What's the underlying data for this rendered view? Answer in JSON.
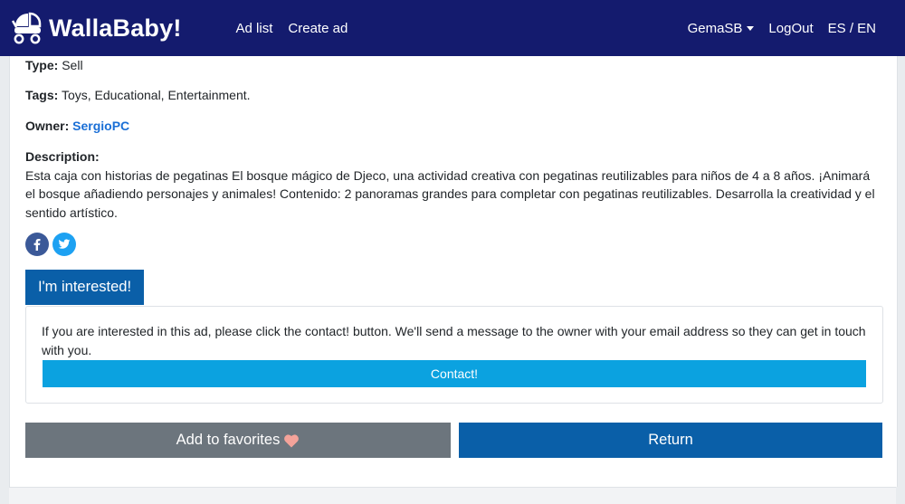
{
  "navbar": {
    "brand": "WallaBaby!",
    "links": [
      "Ad list",
      "Create ad"
    ],
    "user": "GemaSB",
    "logout": "LogOut",
    "lang": "ES / EN",
    "background": "#141b6e"
  },
  "ad": {
    "type_label": "Type:",
    "type_value": "Sell",
    "tags_label": "Tags:",
    "tags_value": "Toys, Educational, Entertainment.",
    "owner_label": "Owner:",
    "owner_value": "SergioPC",
    "description_label": "Description:",
    "description_text": "Esta caja con historias de pegatinas El bosque mágico de Djeco, una actividad creativa con pegatinas reutilizables para niños de 4 a 8 años. ¡Animará el bosque añadiendo personajes y animales! Contenido: 2 panoramas grandes para completar con pegatinas reutilizables. Desarrolla la creatividad y el sentido artístico."
  },
  "social": {
    "icons": [
      "facebook-icon",
      "twitter-icon"
    ]
  },
  "interested_button": "I'm interested!",
  "contact_box": {
    "text": "If you are interested in this ad, please click the contact! button. We'll send a message to the owner with your email address so they can get in touch with you.",
    "button": "Contact!"
  },
  "actions": {
    "favorites": "Add to favorites",
    "return": "Return"
  },
  "colors": {
    "primary": "#0a5fa8",
    "info": "#0ba2e0",
    "secondary": "#6c757d",
    "heart": "#f4a39a"
  }
}
